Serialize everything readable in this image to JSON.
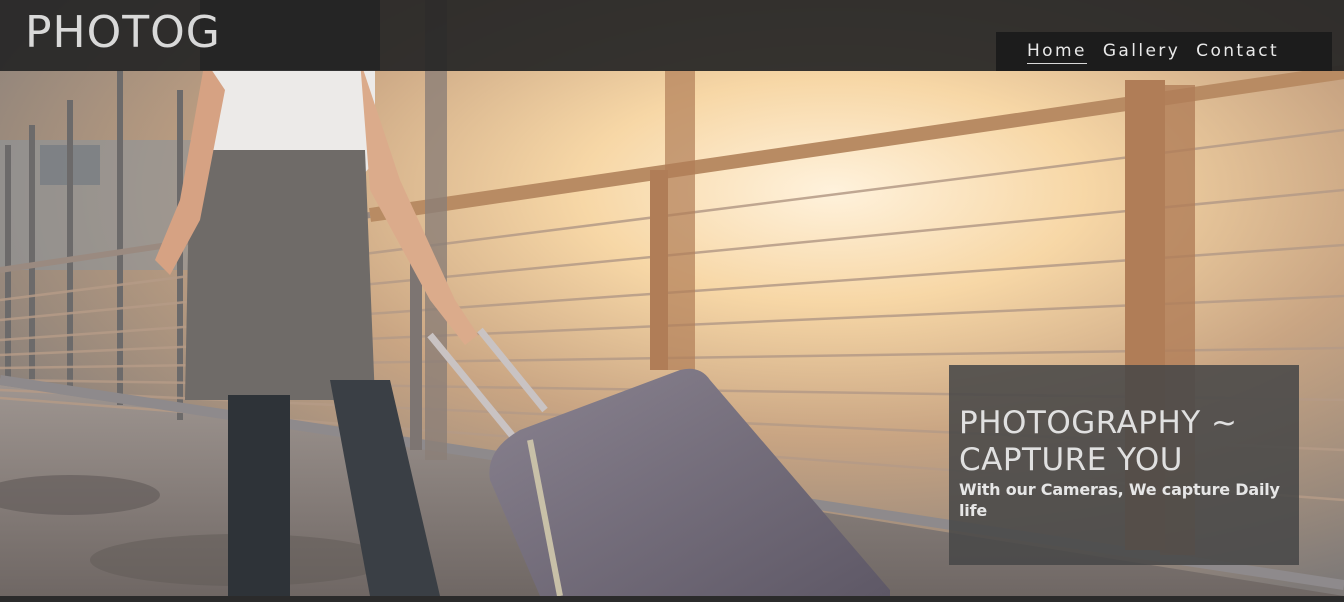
{
  "site": {
    "logo": "PHOTOG"
  },
  "nav": {
    "items": [
      {
        "label": "Home",
        "active": true
      },
      {
        "label": "Gallery",
        "active": false
      },
      {
        "label": "Contact",
        "active": false
      }
    ]
  },
  "hero": {
    "image_subject": "traveler-with-suitcase-at-airport-walkway",
    "caption_title": "PHOTOGRAPHY ~ CAPTURE YOU",
    "caption_subtitle": "With our Cameras, We capture Daily life"
  },
  "colors": {
    "header_bg": "#262626",
    "nav_bg": "#1c1c1c",
    "caption_bg": "#484848",
    "text_light": "#e0e0e0"
  }
}
